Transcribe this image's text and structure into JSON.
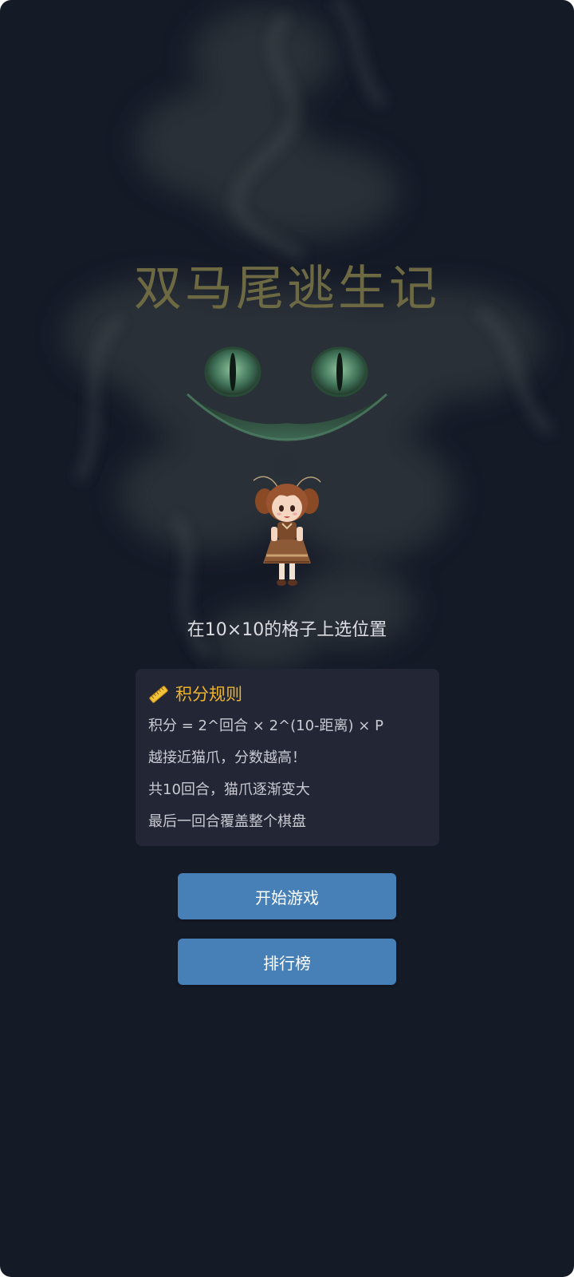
{
  "game": {
    "title": "双马尾逃生记",
    "subtitle": "在10×10的格子上选位置"
  },
  "rules": {
    "icon": "ruler-icon",
    "title": "积分规则",
    "lines": [
      "积分 = 2^回合 × 2^(10-距离) × P",
      "越接近猫爪，分数越高！",
      "共10回合，猫爪逐渐变大",
      "最后一回合覆盖整个棋盘"
    ]
  },
  "buttons": {
    "start": "开始游戏",
    "leaderboard": "排行榜"
  },
  "colors": {
    "background": "#151a27",
    "title": "#6d6a43",
    "rules_title": "#f0b429",
    "panel": "#222635",
    "button": "#4680b6"
  }
}
